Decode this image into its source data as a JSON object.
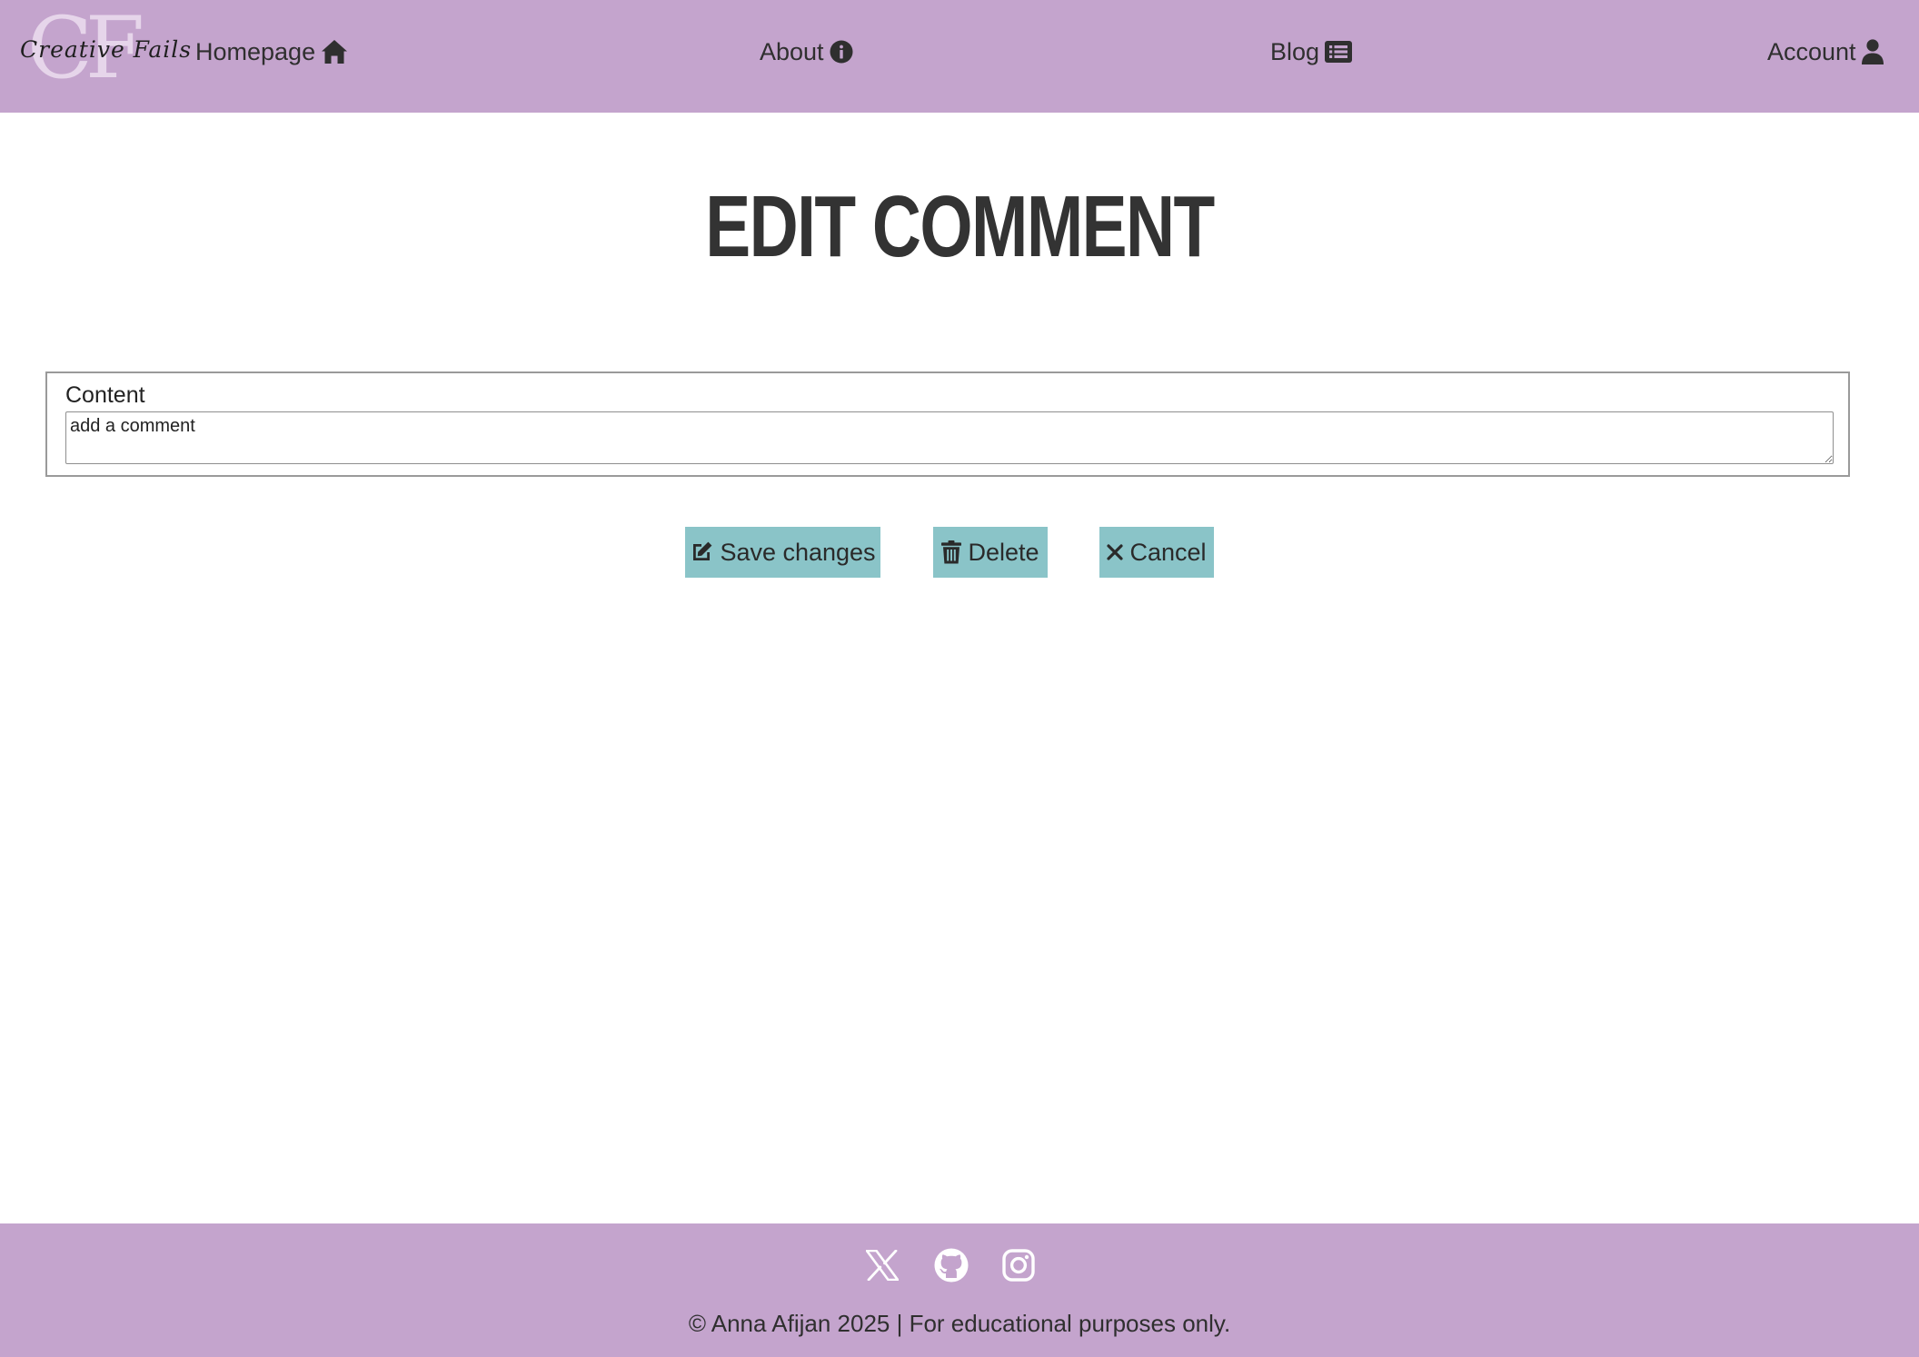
{
  "header": {
    "logo": {
      "monogram": "CF",
      "script_text": "Creative Fails"
    },
    "nav": {
      "home_label": "Homepage",
      "home_icon": "home-icon",
      "about_label": "About",
      "about_icon": "info-circle-icon",
      "blog_label": "Blog",
      "blog_icon": "list-icon",
      "account_label": "Account",
      "account_icon": "user-icon"
    }
  },
  "main": {
    "title": "EDIT COMMENT",
    "form": {
      "content_label": "Content",
      "content_placeholder": "add a comment",
      "content_value": ""
    },
    "buttons": {
      "save_label": "Save changes",
      "save_icon": "edit-icon",
      "delete_label": "Delete",
      "delete_icon": "trash-icon",
      "cancel_label": "Cancel",
      "cancel_icon": "close-icon"
    }
  },
  "footer": {
    "social": [
      "x-icon",
      "github-icon",
      "instagram-icon"
    ],
    "copyright": "© Anna Afijan 2025 | For educational purposes only."
  },
  "colors": {
    "header_bg": "#c4a4cd",
    "footer_bg": "#c4a4cd",
    "button_bg": "#8ac4c8",
    "text": "#333333"
  }
}
